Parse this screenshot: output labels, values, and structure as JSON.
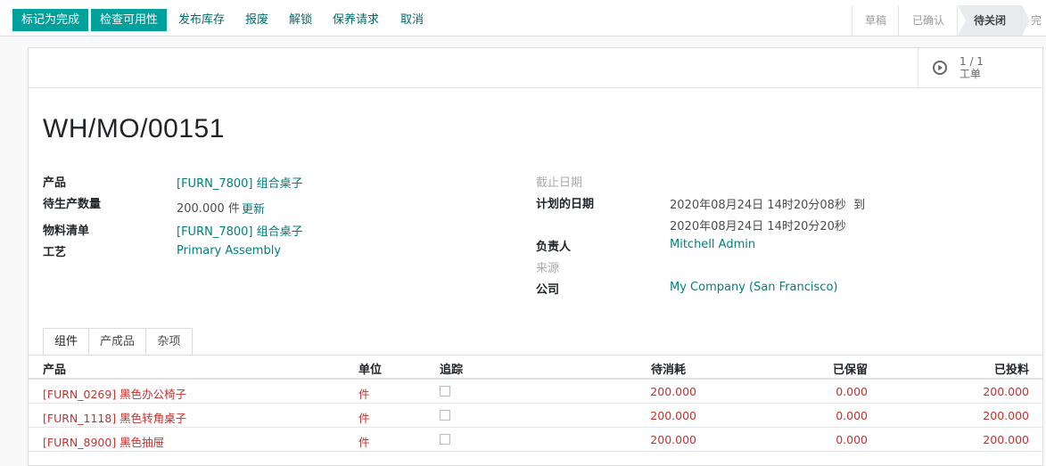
{
  "toolbar": {
    "mark_done": "标记为完成",
    "check_availability": "检查可用性",
    "post_inventory": "发布库存",
    "scrap": "报废",
    "unlock": "解锁",
    "maintenance_request": "保养请求",
    "cancel": "取消"
  },
  "statusbar": {
    "stages": [
      "草稿",
      "已确认",
      "待关闭",
      "完"
    ],
    "active": "待关闭"
  },
  "smart_button": {
    "value": "1 / 1",
    "label": "工单",
    "icon": "play-circle-icon"
  },
  "record": {
    "name": "WH/MO/00151",
    "left": {
      "product_label": "产品",
      "product_value": "[FURN_7800] 组合桌子",
      "qty_label": "待生产数量",
      "qty_value": "200.000 件",
      "qty_update": "更新",
      "bom_label": "物料清单",
      "bom_value": "[FURN_7800] 组合桌子",
      "routing_label": "工艺",
      "routing_value": "Primary Assembly"
    },
    "right": {
      "deadline_label": "截止日期",
      "planned_label": "计划的日期",
      "planned_from": "2020年08月24日 14时20分08秒",
      "planned_to_word": "到",
      "planned_to": "2020年08月24日 14时20分20秒",
      "responsible_label": "负责人",
      "responsible_value": "Mitchell Admin",
      "source_label": "来源",
      "company_label": "公司",
      "company_value": "My Company (San Francisco)"
    }
  },
  "tabs": [
    "组件",
    "产成品",
    "杂项"
  ],
  "table": {
    "headers": [
      "产品",
      "单位",
      "追踪",
      "待消耗",
      "已保留",
      "已投料"
    ],
    "rows": [
      {
        "product": "[FURN_0269] 黑色办公椅子",
        "uom": "件",
        "to_consume": "200.000",
        "reserved": "0.000",
        "consumed": "200.000"
      },
      {
        "product": "[FURN_1118] 黑色转角桌子",
        "uom": "件",
        "to_consume": "200.000",
        "reserved": "0.000",
        "consumed": "200.000"
      },
      {
        "product": "[FURN_8900] 黑色抽屉",
        "uom": "件",
        "to_consume": "200.000",
        "reserved": "0.000",
        "consumed": "200.000"
      }
    ]
  },
  "colors": {
    "primary": "#00a09d",
    "link": "#00807d",
    "danger": "#c9302c"
  }
}
